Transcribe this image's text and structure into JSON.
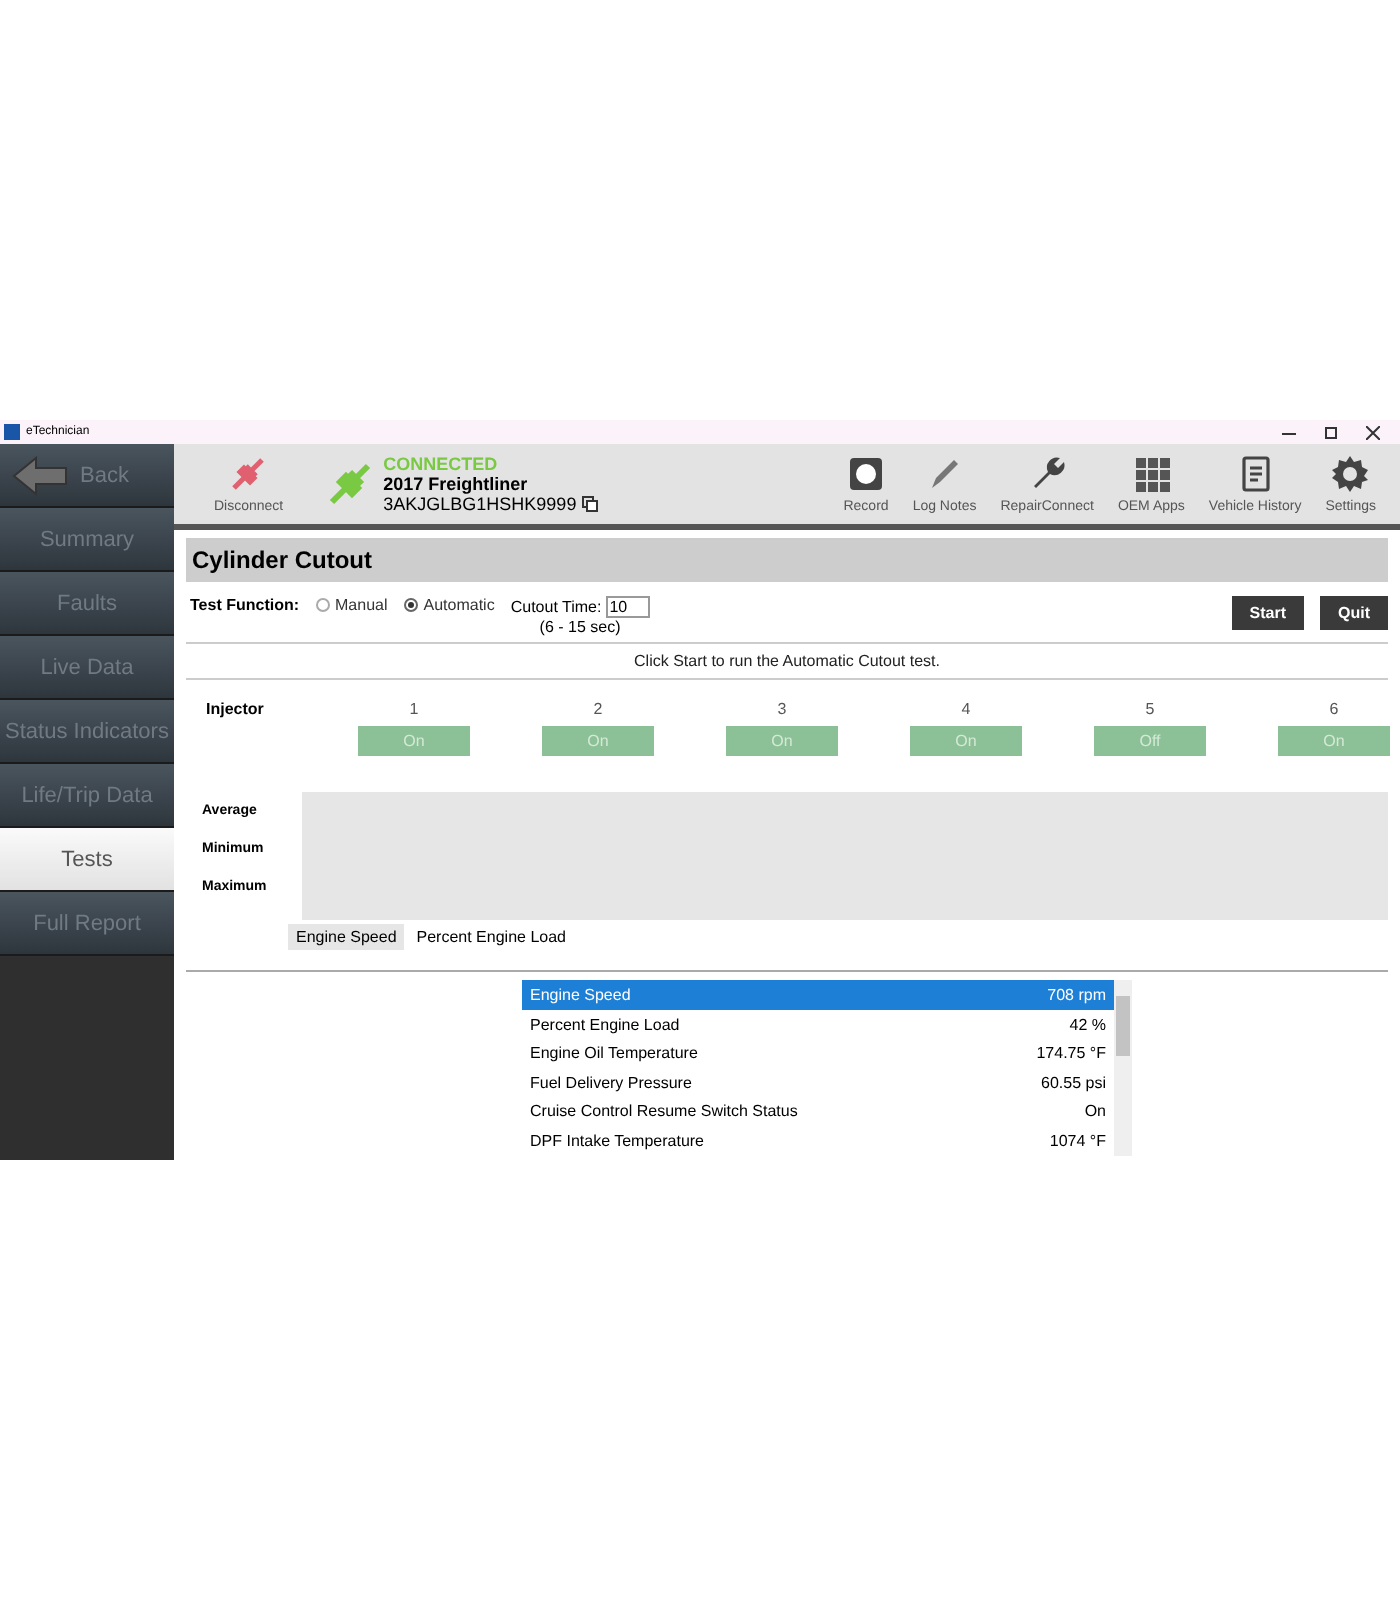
{
  "window": {
    "title": "eTechnician"
  },
  "sidebar": {
    "back": "Back",
    "items": [
      {
        "label": "Summary",
        "selected": false
      },
      {
        "label": "Faults",
        "selected": false
      },
      {
        "label": "Live Data",
        "selected": false
      },
      {
        "label": "Status Indicators",
        "selected": false
      },
      {
        "label": "Life/Trip Data",
        "selected": false
      },
      {
        "label": "Tests",
        "selected": true
      },
      {
        "label": "Full Report",
        "selected": false
      }
    ]
  },
  "toolbar": {
    "disconnect": "Disconnect",
    "status": "CONNECTED",
    "vehicle": "2017 Freightliner",
    "vin": "3AKJGLBG1HSHK9999",
    "actions": [
      {
        "kind": "record",
        "label": "Record"
      },
      {
        "kind": "notes",
        "label": "Log Notes"
      },
      {
        "kind": "wrench",
        "label": "RepairConnect"
      },
      {
        "kind": "grid",
        "label": "OEM Apps"
      },
      {
        "kind": "history",
        "label": "Vehicle History"
      },
      {
        "kind": "settings",
        "label": "Settings"
      }
    ]
  },
  "panel": {
    "title": "Cylinder Cutout",
    "test_function_label": "Test Function:",
    "modes": [
      {
        "label": "Manual",
        "selected": false
      },
      {
        "label": "Automatic",
        "selected": true
      }
    ],
    "cutout_label": "Cutout Time:",
    "cutout_value": "10",
    "cutout_hint": "(6 - 15 sec)",
    "buttons": [
      "Start",
      "Quit"
    ],
    "message": "Click Start to run the Automatic Cutout test.",
    "injector_label": "Injector",
    "injectors": [
      {
        "number": "1",
        "state": "On"
      },
      {
        "number": "2",
        "state": "On"
      },
      {
        "number": "3",
        "state": "On"
      },
      {
        "number": "4",
        "state": "On"
      },
      {
        "number": "5",
        "state": "Off"
      },
      {
        "number": "6",
        "state": "On"
      }
    ],
    "stats": [
      "Average",
      "Minimum",
      "Maximum"
    ],
    "tabs": [
      {
        "label": "Engine Speed",
        "selected": true
      },
      {
        "label": "Percent Engine Load",
        "selected": false
      }
    ],
    "parameters": [
      {
        "name": "Engine Speed",
        "value": "708 rpm",
        "selected": true
      },
      {
        "name": "Percent Engine Load",
        "value": "42 %",
        "selected": false
      },
      {
        "name": "Engine Oil Temperature",
        "value": "174.75 °F",
        "selected": false
      },
      {
        "name": "Fuel Delivery Pressure",
        "value": "60.55 psi",
        "selected": false
      },
      {
        "name": "Cruise Control Resume Switch Status",
        "value": "On",
        "selected": false
      },
      {
        "name": "DPF Intake Temperature",
        "value": "1074 °F",
        "selected": false
      }
    ]
  }
}
